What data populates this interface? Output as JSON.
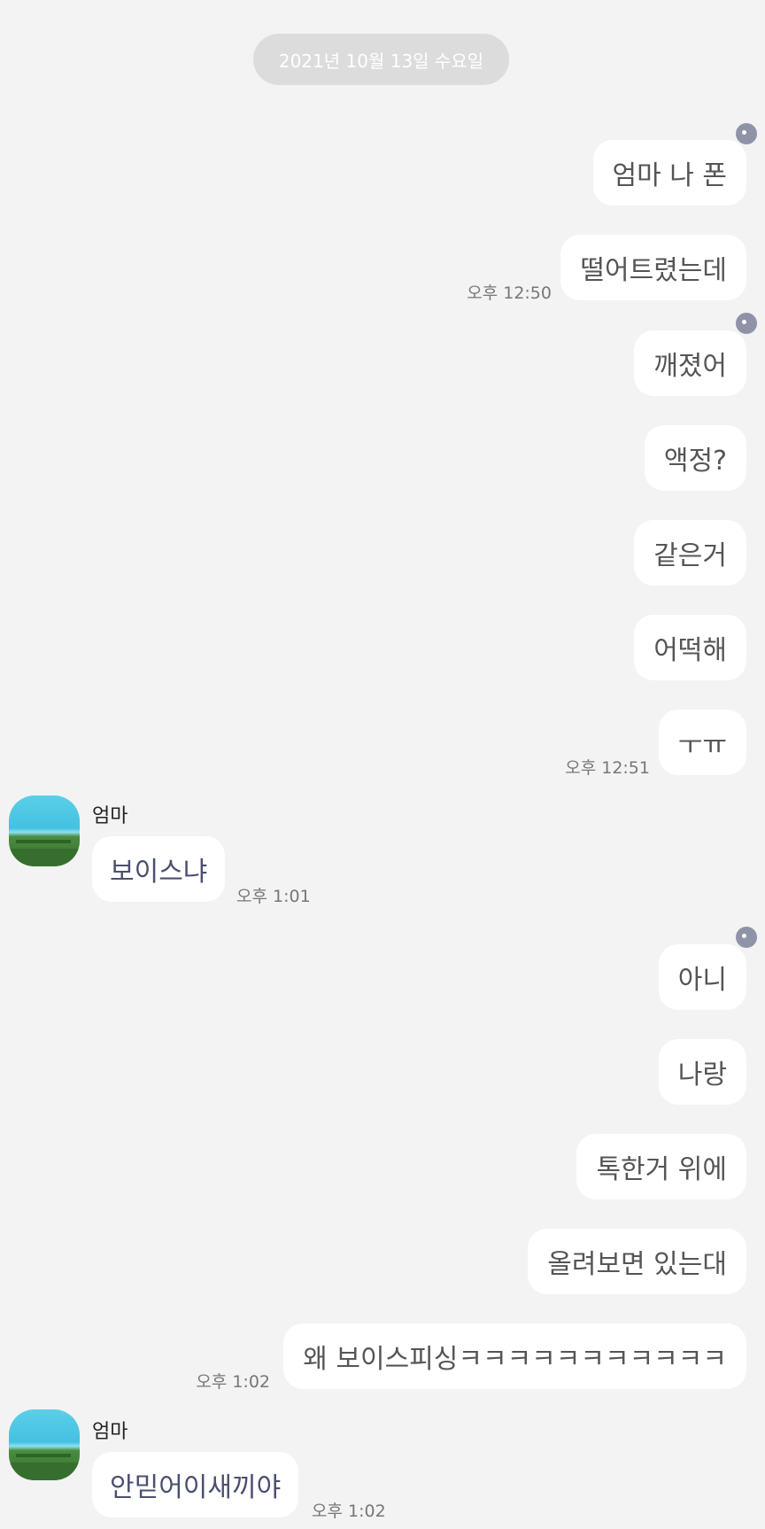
{
  "date_header": "2021년 10월 13일 수요일",
  "messages": [
    {
      "text": "엄마 나 폰"
    },
    {
      "text": "떨어트렸는데",
      "time": "오후 12:50"
    },
    {
      "text": "깨졌어"
    },
    {
      "text": "액정?"
    },
    {
      "text": "같은거"
    },
    {
      "text": "어떡해"
    },
    {
      "text": "ㅜㅠ",
      "time": "오후 12:51"
    },
    {
      "sender": "엄마",
      "text": "보이스냐",
      "time": "오후 1:01"
    },
    {
      "text": "아니"
    },
    {
      "text": "나랑"
    },
    {
      "text": "톡한거 위에"
    },
    {
      "text": "올려보면 있는대"
    },
    {
      "text": "왜 보이스피싱ㅋㅋㅋㅋㅋㅋㅋㅋㅋㅋㅋ",
      "time": "오후 1:02"
    },
    {
      "sender": "엄마",
      "text": "안믿어이새끼야",
      "time": "오후 1:02"
    }
  ],
  "colors": {
    "background": "#f3f3f4",
    "bubble": "#ffffff",
    "date_pill": "#dcdcdc",
    "unread_dot": "#8f93a8",
    "incoming_text": "#4b4f70"
  },
  "icons": {
    "unread": "unread-dot-icon",
    "avatar": "landscape-avatar"
  }
}
